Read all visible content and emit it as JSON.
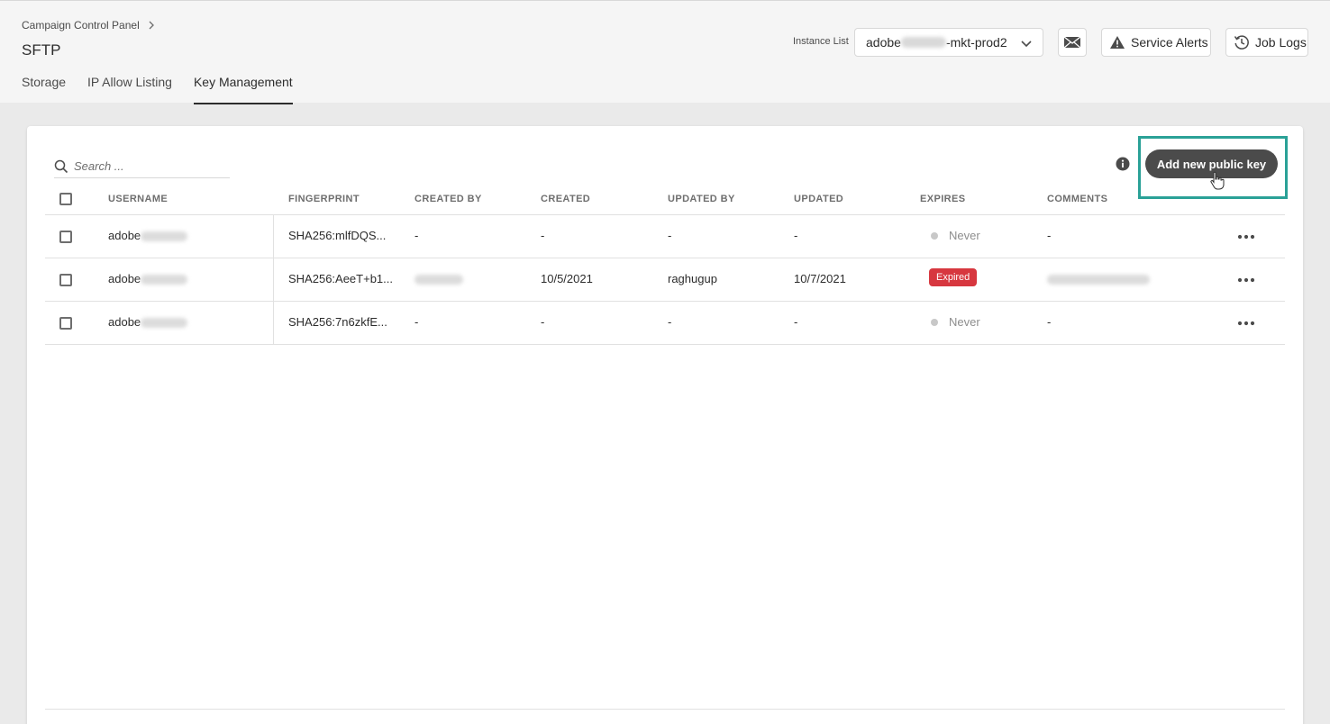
{
  "header": {
    "breadcrumb": "Campaign Control Panel",
    "title": "SFTP",
    "tabs": [
      "Storage",
      "IP Allow Listing",
      "Key Management"
    ],
    "active_tab": "Key Management",
    "instance_label": "Instance List",
    "instance_value_prefix": "adobe",
    "instance_value_suffix": "-mkt-prod2",
    "service_alerts_label": "Service Alerts",
    "job_logs_label": "Job Logs"
  },
  "toolbar": {
    "search_placeholder": "Search ...",
    "add_key_label": "Add new public key"
  },
  "table": {
    "columns": [
      "USERNAME",
      "FINGERPRINT",
      "CREATED BY",
      "CREATED",
      "UPDATED BY",
      "UPDATED",
      "EXPIRES",
      "COMMENTS"
    ],
    "rows": [
      {
        "username": "adobe",
        "fingerprint": "SHA256:mlfDQS...",
        "created_by": "-",
        "created": "-",
        "updated_by": "-",
        "updated": "-",
        "expires": "Never",
        "comments": "-"
      },
      {
        "username": "adobe",
        "fingerprint": "SHA256:AeeT+b1...",
        "created_by": "",
        "created": "10/5/2021",
        "updated_by": "raghugup",
        "updated": "10/7/2021",
        "expires": "Expired",
        "comments": ""
      },
      {
        "username": "adobe",
        "fingerprint": "SHA256:7n6zkfE...",
        "created_by": "-",
        "created": "-",
        "updated_by": "-",
        "updated": "-",
        "expires": "Never",
        "comments": "-"
      }
    ]
  },
  "colors": {
    "accent_highlight": "#2aa197",
    "expired_badge": "#d7373f",
    "primary_button": "#4b4b4b"
  },
  "icons": [
    "chevron-right-icon",
    "chevron-down-icon",
    "mail-icon",
    "alert-icon",
    "history-icon",
    "search-icon",
    "info-icon",
    "more-icon",
    "hand-cursor-icon"
  ]
}
